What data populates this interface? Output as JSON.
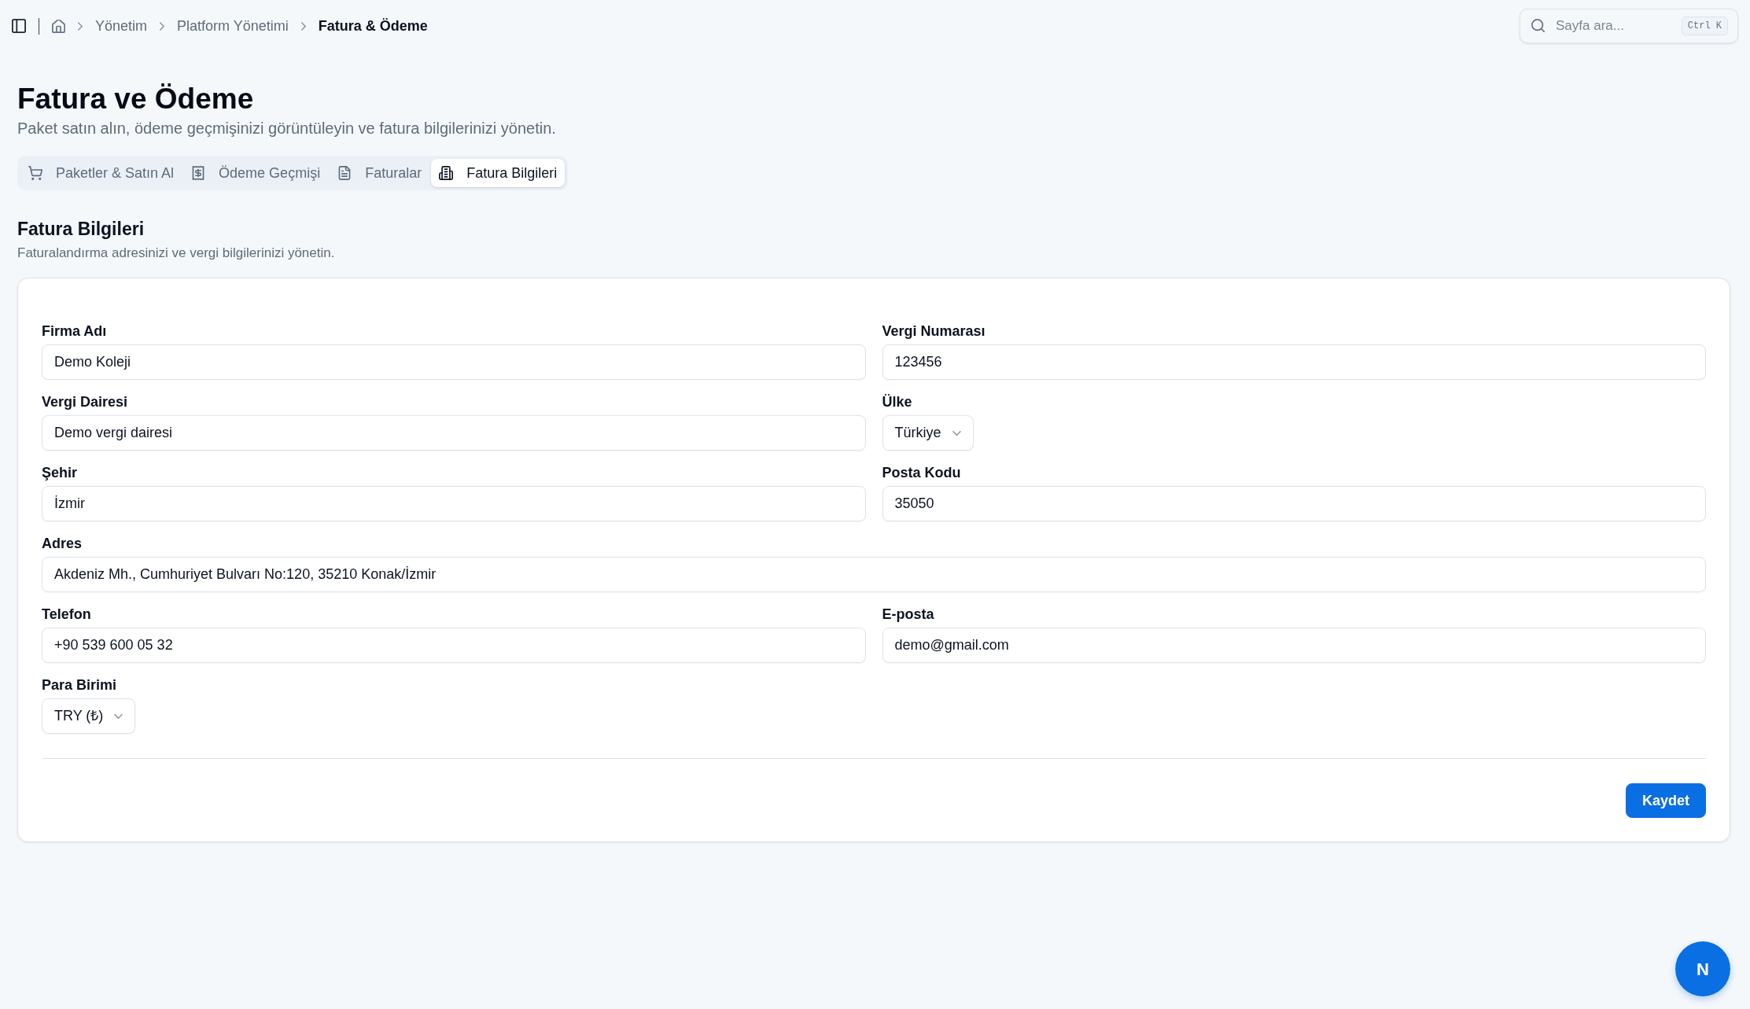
{
  "top_bar": {
    "breadcrumb": [
      {
        "label": "Yönetim",
        "current": false
      },
      {
        "label": "Platform Yönetimi",
        "current": false
      },
      {
        "label": "Fatura & Ödeme",
        "current": true
      }
    ],
    "search": {
      "placeholder": "Sayfa ara...",
      "shortcut": "Ctrl K"
    }
  },
  "page": {
    "title": "Fatura ve Ödeme",
    "subtitle": "Paket satın alın, ödeme geçmişinizi görüntüleyin ve fatura bilgilerinizi yönetin."
  },
  "tabs": [
    {
      "label": "Paketler & Satın Al",
      "selected": false
    },
    {
      "label": "Ödeme Geçmişi",
      "selected": false
    },
    {
      "label": "Faturalar",
      "selected": false
    },
    {
      "label": "Fatura Bilgileri",
      "selected": true
    }
  ],
  "section": {
    "title": "Fatura Bilgileri",
    "description": "Faturalandırma adresinizi ve vergi bilgilerinizi yönetin."
  },
  "form": {
    "rows": [
      [
        {
          "label": "Firma Adı",
          "kind": "text",
          "value": "Demo Koleji"
        },
        {
          "label": "Vergi Numarası",
          "kind": "text",
          "value": "123456"
        }
      ],
      [
        {
          "label": "Vergi Dairesi",
          "kind": "text",
          "value": "Demo vergi dairesi"
        },
        {
          "label": "Ülke",
          "kind": "select",
          "value": "Türkiye"
        }
      ],
      [
        {
          "label": "Şehir",
          "kind": "text",
          "value": "İzmir"
        },
        {
          "label": "Posta Kodu",
          "kind": "text",
          "value": "35050"
        }
      ],
      [
        {
          "label": "Adres",
          "kind": "text",
          "value": "Akdeniz Mh., Cumhuriyet Bulvarı No:120, 35210 Konak/İzmir"
        }
      ],
      [
        {
          "label": "Telefon",
          "kind": "text",
          "value": "+90 539 600 05 32"
        },
        {
          "label": "E-posta",
          "kind": "text",
          "value": "demo@gmail.com"
        }
      ],
      [
        {
          "label": "Para Birimi",
          "kind": "select",
          "value": "TRY (₺)"
        }
      ]
    ],
    "save_button": "Kaydet"
  },
  "floating_button": {
    "label": "N"
  }
}
